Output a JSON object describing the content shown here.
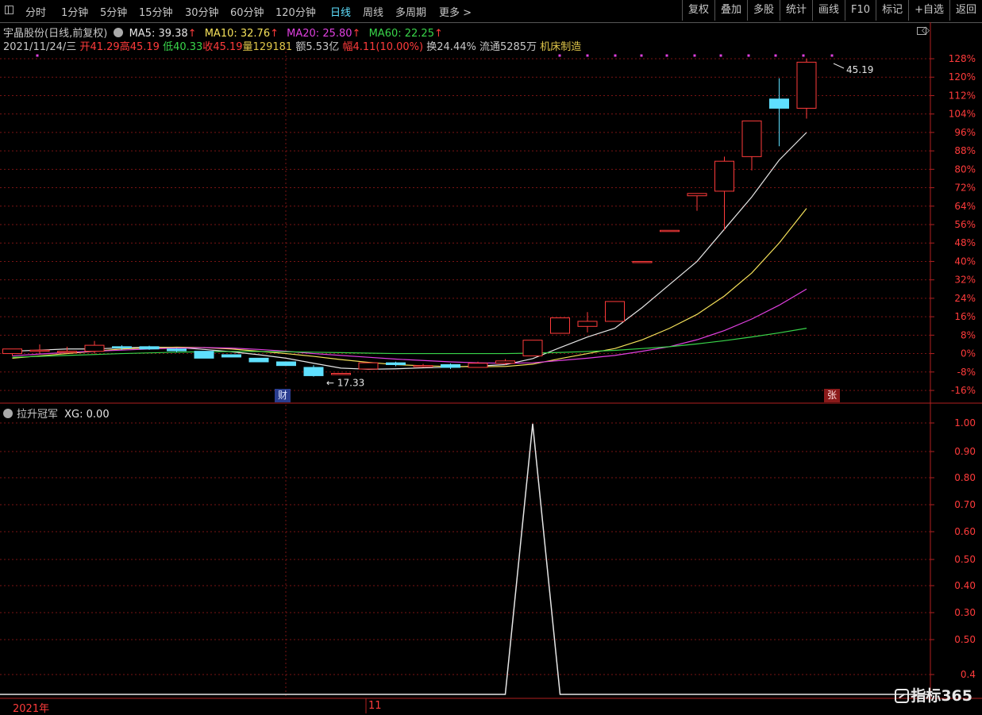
{
  "toolbar": {
    "left_items": [
      "分时",
      "1分钟",
      "5分钟",
      "15分钟",
      "30分钟",
      "60分钟",
      "120分钟",
      "日线",
      "周线",
      "多周期",
      "更多 >"
    ],
    "active_item": "日线",
    "right_items": [
      "复权",
      "叠加",
      "多股",
      "统计",
      "画线",
      "F10",
      "标记",
      "+自选",
      "返回"
    ]
  },
  "header": {
    "stock_name": "宇晶股份(日线,前复权)",
    "ma5": "MA5: 39.38",
    "ma10": "MA10: 32.76",
    "ma20": "MA20: 25.80",
    "ma60": "MA60: 22.25",
    "arrow": "↑"
  },
  "quote": {
    "date": "2021/11/24/三",
    "open_label": "开",
    "open": "41.29",
    "high_label": "高",
    "high": "45.19",
    "low_label": "低",
    "low": "40.33",
    "close_label": "收",
    "close": "45.19",
    "vol_label": "量",
    "vol": "129181",
    "amount_label": "额",
    "amount": "5.53亿",
    "change_label": "幅",
    "change": "4.11(10.00%)",
    "turnover": "换24.44%",
    "float": "流通5285万",
    "industry": "机床制造"
  },
  "indicator": {
    "name": "拉升冠军",
    "value": "XG: 0.00"
  },
  "x_axis": {
    "year_label": "2021年",
    "month_label": "11"
  },
  "badges": {
    "cai": "财",
    "zhang": "张"
  },
  "watermark": "指标365",
  "colors": {
    "up": "#ff3b3b",
    "down": "#5fe0ff",
    "ma5": "#e6e6e6",
    "ma10": "#f5e15a",
    "ma20": "#e040e0",
    "ma60": "#39d54a",
    "grid": "#7a1414",
    "axis": "#b02020"
  },
  "chart_data": [
    {
      "type": "candlestick",
      "y_unit": "%",
      "ylim": [
        -16,
        128
      ],
      "y_ticks": [
        "128%",
        "120%",
        "112%",
        "104%",
        "96%",
        "88%",
        "80%",
        "72%",
        "64%",
        "56%",
        "48%",
        "40%",
        "32%",
        "24%",
        "16%",
        "8%",
        "0%",
        "-8%",
        "-16%"
      ],
      "max_label": "45.19",
      "min_label": "17.33",
      "candles": [
        {
          "o": 0,
          "c": 2,
          "h": 2,
          "l": -1
        },
        {
          "o": 1.5,
          "c": 1.5,
          "h": 4,
          "l": 0
        },
        {
          "o": 1,
          "c": 1,
          "h": 3,
          "l": 0
        },
        {
          "o": 1,
          "c": 3.6,
          "h": 5.5,
          "l": 0
        },
        {
          "o": 3,
          "c": 2.6,
          "h": 3.6,
          "l": 1.6
        },
        {
          "o": 3,
          "c": 2,
          "h": 3.4,
          "l": 1.6
        },
        {
          "o": 2,
          "c": 1.2,
          "h": 2.4,
          "l": 0.6
        },
        {
          "o": 1,
          "c": -2,
          "h": 1,
          "l": -2
        },
        {
          "o": -0.5,
          "c": -1.5,
          "h": -0.5,
          "l": -1.5
        },
        {
          "o": -2,
          "c": -3.6,
          "h": -2,
          "l": -3.6
        },
        {
          "o": -3.6,
          "c": -5.2,
          "h": -3.6,
          "l": -5.2
        },
        {
          "o": -6,
          "c": -9.6,
          "h": -5,
          "l": -10
        },
        {
          "o": -8.6,
          "c": -8.6,
          "h": -8.6,
          "l": -8.6
        },
        {
          "o": -6.7,
          "c": -4,
          "h": -4,
          "l": -6.7
        },
        {
          "o": -4,
          "c": -4.8,
          "h": -3.5,
          "l": -5.5
        },
        {
          "o": -5.5,
          "c": -5.2,
          "h": -4.5,
          "l": -6.0
        },
        {
          "o": -4.8,
          "c": -6.0,
          "h": -4.3,
          "l": -6.7
        },
        {
          "o": -6.0,
          "c": -4.2,
          "h": -3.5,
          "l": -6.0
        },
        {
          "o": -4.2,
          "c": -3.2,
          "h": -2.4,
          "l": -4.8
        },
        {
          "o": -1,
          "c": 5.8,
          "h": 5.8,
          "l": -1
        },
        {
          "o": 8.8,
          "c": 15.5,
          "h": 15.5,
          "l": 8.8
        },
        {
          "o": 11.8,
          "c": 14.0,
          "h": 18.0,
          "l": 9.2
        },
        {
          "o": 14.0,
          "c": 22.6,
          "h": 22.6,
          "l": 14.0
        },
        {
          "o": 40.0,
          "c": 40.0,
          "h": 40.0,
          "l": 40.0
        },
        {
          "o": 53.5,
          "c": 53.5,
          "h": 53.5,
          "l": 53.5
        },
        {
          "o": 68.5,
          "c": 69.5,
          "h": 69.5,
          "l": 62.0
        },
        {
          "o": 70.5,
          "c": 83.5,
          "h": 85.5,
          "l": 53.5
        },
        {
          "o": 85.5,
          "c": 101.0,
          "h": 101.0,
          "l": 79.5
        },
        {
          "o": 110.5,
          "c": 106.5,
          "h": 119.5,
          "l": 90.0
        },
        {
          "o": 106.5,
          "c": 126.5,
          "h": 128.0,
          "l": 102.0
        }
      ],
      "series": [
        {
          "name": "MA5",
          "values": [
            1,
            1.5,
            2,
            2,
            2.5,
            2.8,
            2.7,
            1.8,
            0.8,
            -0.5,
            -2,
            -4.2,
            -6.3,
            -6.8,
            -6.6,
            -6.2,
            -5.9,
            -5.4,
            -4.8,
            -2.2,
            2.6,
            7.2,
            11.0,
            20.0,
            30.0,
            40.0,
            54.0,
            68.0,
            84.0,
            96.0
          ]
        },
        {
          "name": "MA10",
          "values": [
            -2,
            -1,
            0,
            1,
            2,
            2.5,
            2.8,
            2.6,
            2.0,
            1.0,
            0,
            -1.2,
            -2.6,
            -3.8,
            -4.8,
            -5.3,
            -5.6,
            -5.7,
            -5.6,
            -4.6,
            -2.2,
            0,
            2.2,
            6.0,
            11.0,
            17.0,
            25.0,
            35.0,
            48.0,
            63.0
          ]
        },
        {
          "name": "MA20",
          "values": [
            -1,
            -0.2,
            0.5,
            1,
            1.5,
            2.0,
            2.4,
            2.6,
            2.4,
            1.8,
            1.0,
            0,
            -0.8,
            -1.6,
            -2.4,
            -3.0,
            -3.6,
            -4.0,
            -4.2,
            -4.0,
            -3.0,
            -2.0,
            -0.8,
            1.0,
            3.0,
            6.0,
            10.0,
            15.0,
            21.0,
            28.0
          ]
        },
        {
          "name": "MA60",
          "values": [
            -1.6,
            -1.2,
            -0.8,
            -0.4,
            0,
            0.3,
            0.6,
            0.8,
            0.9,
            0.9,
            0.8,
            0.6,
            0.4,
            0.2,
            0,
            0,
            0,
            0,
            0,
            0.2,
            0.5,
            0.9,
            1.4,
            2.2,
            3.0,
            4.2,
            5.6,
            7.2,
            9.0,
            11.0
          ]
        }
      ]
    },
    {
      "type": "line",
      "title": "拉升冠军",
      "ylim": [
        0.4,
        1.0
      ],
      "y_ticks": [
        "1.00",
        "0.90",
        "0.80",
        "0.70",
        "0.60",
        "0.50",
        "0.40",
        "0.30",
        "0.50",
        "0.4"
      ],
      "series": [
        {
          "name": "XG",
          "values": [
            0,
            0,
            0,
            0,
            0,
            0,
            0,
            0,
            0,
            0,
            0,
            0,
            0,
            0,
            0,
            0,
            0,
            0,
            0,
            1,
            0,
            0,
            0,
            0,
            0,
            0,
            0,
            0,
            0,
            0
          ]
        }
      ]
    }
  ]
}
